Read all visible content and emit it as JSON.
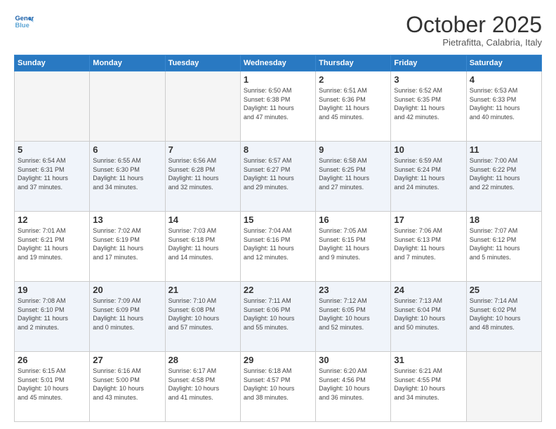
{
  "logo": {
    "line1": "General",
    "line2": "Blue"
  },
  "title": "October 2025",
  "subtitle": "Pietrafitta, Calabria, Italy",
  "headers": [
    "Sunday",
    "Monday",
    "Tuesday",
    "Wednesday",
    "Thursday",
    "Friday",
    "Saturday"
  ],
  "weeks": [
    [
      {
        "day": "",
        "info": ""
      },
      {
        "day": "",
        "info": ""
      },
      {
        "day": "",
        "info": ""
      },
      {
        "day": "1",
        "info": "Sunrise: 6:50 AM\nSunset: 6:38 PM\nDaylight: 11 hours\nand 47 minutes."
      },
      {
        "day": "2",
        "info": "Sunrise: 6:51 AM\nSunset: 6:36 PM\nDaylight: 11 hours\nand 45 minutes."
      },
      {
        "day": "3",
        "info": "Sunrise: 6:52 AM\nSunset: 6:35 PM\nDaylight: 11 hours\nand 42 minutes."
      },
      {
        "day": "4",
        "info": "Sunrise: 6:53 AM\nSunset: 6:33 PM\nDaylight: 11 hours\nand 40 minutes."
      }
    ],
    [
      {
        "day": "5",
        "info": "Sunrise: 6:54 AM\nSunset: 6:31 PM\nDaylight: 11 hours\nand 37 minutes."
      },
      {
        "day": "6",
        "info": "Sunrise: 6:55 AM\nSunset: 6:30 PM\nDaylight: 11 hours\nand 34 minutes."
      },
      {
        "day": "7",
        "info": "Sunrise: 6:56 AM\nSunset: 6:28 PM\nDaylight: 11 hours\nand 32 minutes."
      },
      {
        "day": "8",
        "info": "Sunrise: 6:57 AM\nSunset: 6:27 PM\nDaylight: 11 hours\nand 29 minutes."
      },
      {
        "day": "9",
        "info": "Sunrise: 6:58 AM\nSunset: 6:25 PM\nDaylight: 11 hours\nand 27 minutes."
      },
      {
        "day": "10",
        "info": "Sunrise: 6:59 AM\nSunset: 6:24 PM\nDaylight: 11 hours\nand 24 minutes."
      },
      {
        "day": "11",
        "info": "Sunrise: 7:00 AM\nSunset: 6:22 PM\nDaylight: 11 hours\nand 22 minutes."
      }
    ],
    [
      {
        "day": "12",
        "info": "Sunrise: 7:01 AM\nSunset: 6:21 PM\nDaylight: 11 hours\nand 19 minutes."
      },
      {
        "day": "13",
        "info": "Sunrise: 7:02 AM\nSunset: 6:19 PM\nDaylight: 11 hours\nand 17 minutes."
      },
      {
        "day": "14",
        "info": "Sunrise: 7:03 AM\nSunset: 6:18 PM\nDaylight: 11 hours\nand 14 minutes."
      },
      {
        "day": "15",
        "info": "Sunrise: 7:04 AM\nSunset: 6:16 PM\nDaylight: 11 hours\nand 12 minutes."
      },
      {
        "day": "16",
        "info": "Sunrise: 7:05 AM\nSunset: 6:15 PM\nDaylight: 11 hours\nand 9 minutes."
      },
      {
        "day": "17",
        "info": "Sunrise: 7:06 AM\nSunset: 6:13 PM\nDaylight: 11 hours\nand 7 minutes."
      },
      {
        "day": "18",
        "info": "Sunrise: 7:07 AM\nSunset: 6:12 PM\nDaylight: 11 hours\nand 5 minutes."
      }
    ],
    [
      {
        "day": "19",
        "info": "Sunrise: 7:08 AM\nSunset: 6:10 PM\nDaylight: 11 hours\nand 2 minutes."
      },
      {
        "day": "20",
        "info": "Sunrise: 7:09 AM\nSunset: 6:09 PM\nDaylight: 11 hours\nand 0 minutes."
      },
      {
        "day": "21",
        "info": "Sunrise: 7:10 AM\nSunset: 6:08 PM\nDaylight: 10 hours\nand 57 minutes."
      },
      {
        "day": "22",
        "info": "Sunrise: 7:11 AM\nSunset: 6:06 PM\nDaylight: 10 hours\nand 55 minutes."
      },
      {
        "day": "23",
        "info": "Sunrise: 7:12 AM\nSunset: 6:05 PM\nDaylight: 10 hours\nand 52 minutes."
      },
      {
        "day": "24",
        "info": "Sunrise: 7:13 AM\nSunset: 6:04 PM\nDaylight: 10 hours\nand 50 minutes."
      },
      {
        "day": "25",
        "info": "Sunrise: 7:14 AM\nSunset: 6:02 PM\nDaylight: 10 hours\nand 48 minutes."
      }
    ],
    [
      {
        "day": "26",
        "info": "Sunrise: 6:15 AM\nSunset: 5:01 PM\nDaylight: 10 hours\nand 45 minutes."
      },
      {
        "day": "27",
        "info": "Sunrise: 6:16 AM\nSunset: 5:00 PM\nDaylight: 10 hours\nand 43 minutes."
      },
      {
        "day": "28",
        "info": "Sunrise: 6:17 AM\nSunset: 4:58 PM\nDaylight: 10 hours\nand 41 minutes."
      },
      {
        "day": "29",
        "info": "Sunrise: 6:18 AM\nSunset: 4:57 PM\nDaylight: 10 hours\nand 38 minutes."
      },
      {
        "day": "30",
        "info": "Sunrise: 6:20 AM\nSunset: 4:56 PM\nDaylight: 10 hours\nand 36 minutes."
      },
      {
        "day": "31",
        "info": "Sunrise: 6:21 AM\nSunset: 4:55 PM\nDaylight: 10 hours\nand 34 minutes."
      },
      {
        "day": "",
        "info": ""
      }
    ]
  ]
}
